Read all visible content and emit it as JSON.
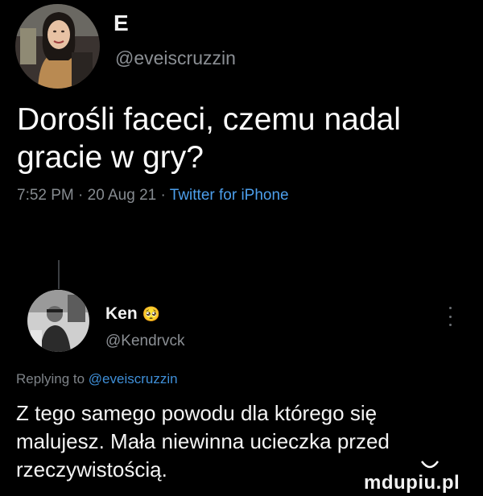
{
  "original_tweet": {
    "display_name": "E",
    "handle": "@eveiscruzzin",
    "text": "Dorośli faceci, czemu nadal gracie w gry?",
    "timestamp": "7:52 PM · 20 Aug 21 · ",
    "source": "Twitter for iPhone"
  },
  "reply": {
    "display_name": "Ken",
    "name_emoji": "🥺",
    "handle": "@Kendrvck",
    "replying_prefix": "Replying to ",
    "replying_mention": "@eveiscruzzin",
    "text": "Z tego samego powodu dla którego się malujesz. Mała niewinna ucieczka przed rzeczywistością."
  },
  "watermark": {
    "text": "mdupiu.pl"
  },
  "icons": {
    "more": "more-vertical-icon"
  }
}
